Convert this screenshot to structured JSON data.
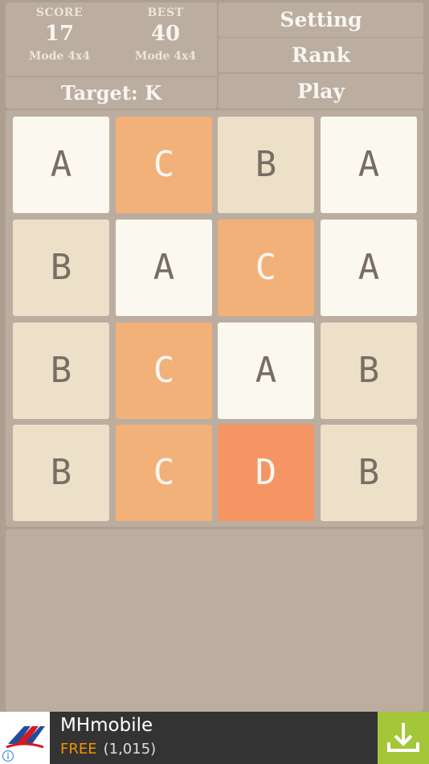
{
  "header": {
    "score_label": "SCORE",
    "score_value": "17",
    "score_mode": "Mode 4x4",
    "best_label": "BEST",
    "best_value": "40",
    "best_mode": "Mode 4x4",
    "target": "Target: K"
  },
  "menu": {
    "setting": "Setting",
    "rank": "Rank",
    "play": "Play"
  },
  "board": {
    "rows": [
      [
        "A",
        "C",
        "B",
        "A"
      ],
      [
        "B",
        "A",
        "C",
        "A"
      ],
      [
        "B",
        "C",
        "A",
        "B"
      ],
      [
        "B",
        "C",
        "D",
        "B"
      ]
    ]
  },
  "ad": {
    "title": "MHmobile",
    "price": "FREE",
    "rating": "(1,015)",
    "icons": {
      "logo": "airline-logo-icon",
      "download": "download-icon",
      "info": "info-icon"
    },
    "colors": {
      "free": "#f29400",
      "download_bg": "#a4c639"
    }
  }
}
